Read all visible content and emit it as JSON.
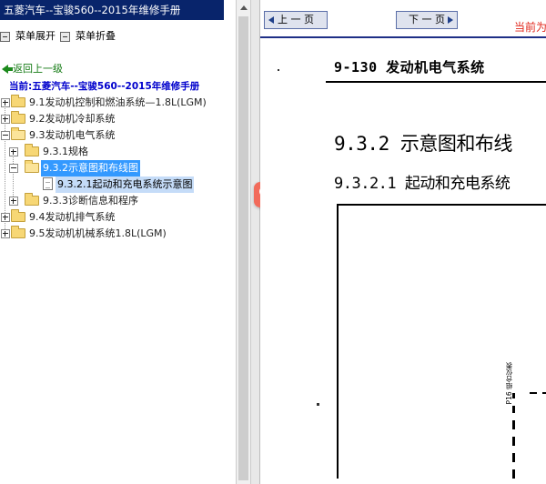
{
  "window": {
    "title": "五菱汽车--宝骏560--2015年维修手册"
  },
  "toolbar": {
    "expand_label": "菜单展开",
    "collapse_label": "菜单折叠"
  },
  "nav": {
    "back_label": "返回上一级",
    "current_label": "当前:五菱汽车--宝骏560--2015年维修手册"
  },
  "tree": {
    "n1": "9.1发动机控制和燃油系统—1.8L(LGM)",
    "n2": "9.2发动机冷却系统",
    "n3": "9.3发动机电气系统",
    "n3_1": "9.3.1规格",
    "n3_2": "9.3.2示意图和布线图",
    "n3_2_1": "9.3.2.1起动和充电系统示意图",
    "n3_3": "9.3.3诊断信息和程序",
    "n4": "9.4发动机排气系统",
    "n5": "9.5发动机机械系统1.8L(LGM)"
  },
  "viewer": {
    "prev_label": "上 一 页",
    "next_label": "下 一 页",
    "current_page_label": "当前为"
  },
  "document": {
    "page_header": "9-130 发动机电气系统",
    "section_title": "9.3.2 示意图和布线",
    "subsection_title": "9.3.2.1 起动和充电系统",
    "diagram_label": "P16 组合仪表"
  },
  "colors": {
    "titlebar": "#08246b",
    "selection": "#3399ff",
    "current_link": "#0000cc",
    "back_link": "#137a13",
    "page_indicator": "#e0261a",
    "search_button": "#f26b5b"
  },
  "icons": {
    "search": "search-icon",
    "folder": "folder-icon",
    "document": "document-icon",
    "back": "back-arrow-icon"
  }
}
